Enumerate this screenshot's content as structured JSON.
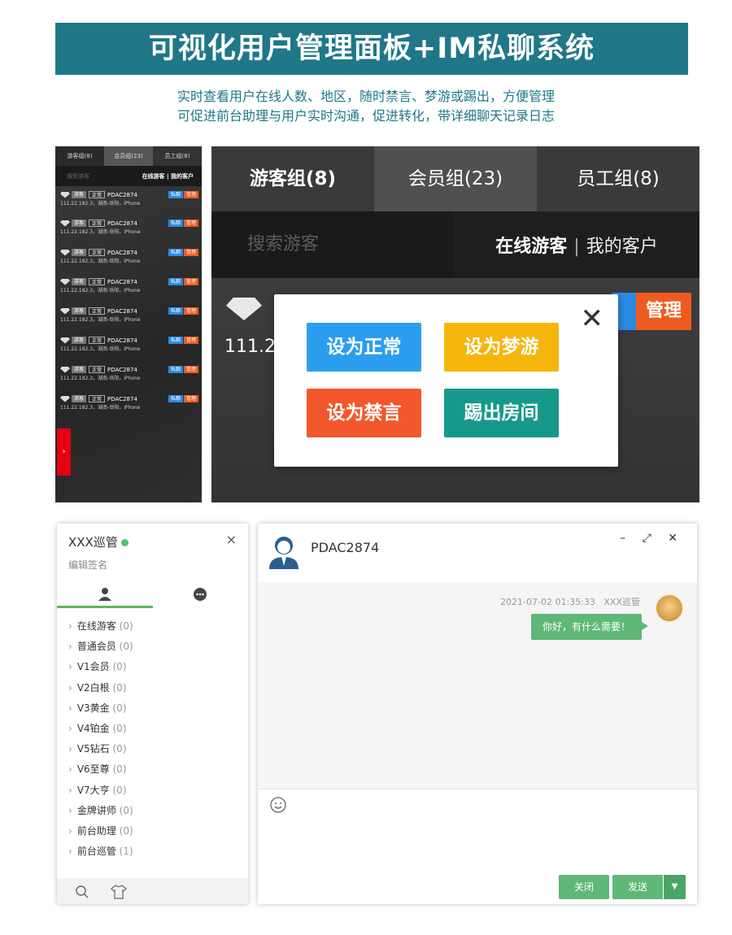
{
  "header": {
    "title": "可视化用户管理面板+IM私聊系统",
    "line1": "实时查看用户在线人数、地区，随时禁言、梦游或踢出，方便管理",
    "line2": "可促进前台助理与用户实时沟通，促进转化，带详细聊天记录日志"
  },
  "small_panel": {
    "tabs": [
      "游客组(8)",
      "会员组(23)",
      "员工组(8)"
    ],
    "search_placeholder": "搜索游客",
    "online_label": "在线游客 | 我的客户",
    "items": [
      {
        "tag": "游客",
        "status": "正常",
        "name": "PDAC2874",
        "info": "111.22.182.3，湖南-岳阳，iPhone",
        "chat": "私聊",
        "manage": "管理"
      },
      {
        "tag": "游客",
        "status": "正常",
        "name": "PDAC2874",
        "info": "111.22.182.3，湖南-岳阳，iPhone",
        "chat": "私聊",
        "manage": "管理"
      },
      {
        "tag": "游客",
        "status": "正常",
        "name": "PDAC2874",
        "info": "111.22.182.3，湖南-岳阳，iPhone",
        "chat": "私聊",
        "manage": "管理"
      },
      {
        "tag": "游客",
        "status": "正常",
        "name": "PDAC2874",
        "info": "111.22.182.3，湖南-岳阳，iPhone",
        "chat": "私聊",
        "manage": "管理"
      },
      {
        "tag": "游客",
        "status": "正常",
        "name": "PDAC2874",
        "info": "111.22.182.3，湖南-岳阳，iPhone",
        "chat": "私聊",
        "manage": "管理"
      },
      {
        "tag": "游客",
        "status": "正常",
        "name": "PDAC2874",
        "info": "111.22.182.3，湖南-岳阳，iPhone",
        "chat": "私聊",
        "manage": "管理"
      },
      {
        "tag": "游客",
        "status": "正常",
        "name": "PDAC2874",
        "info": "111.22.182.3，湖南-岳阳，iPhone",
        "chat": "私聊",
        "manage": "管理"
      },
      {
        "tag": "游客",
        "status": "正常",
        "name": "PDAC2874",
        "info": "111.22.182.3，湖南-岳阳，iPhone",
        "chat": "私聊",
        "manage": "管理"
      }
    ],
    "side_toggle": "›"
  },
  "big_panel": {
    "tabs": [
      "游客组(8)",
      "会员组(23)",
      "员工组(8)"
    ],
    "search_placeholder": "搜索游客",
    "online_label": "在线游客",
    "sep": "|",
    "my_customers": "我的客户",
    "ip_partial": "111.2",
    "manage": "管理"
  },
  "modal": {
    "close": "✕",
    "buttons": [
      {
        "label": "设为正常",
        "color": "#2b9ef0"
      },
      {
        "label": "设为梦游",
        "color": "#f5b50b"
      },
      {
        "label": "设为禁言",
        "color": "#f2582b"
      },
      {
        "label": "踢出房间",
        "color": "#16998a"
      }
    ]
  },
  "im_left": {
    "name": "XXX巡管",
    "close": "×",
    "signature": "编辑签名",
    "groups": [
      {
        "name": "在线游客",
        "count": "(0)"
      },
      {
        "name": "普通会员",
        "count": "(0)"
      },
      {
        "name": "V1会员",
        "count": "(0)"
      },
      {
        "name": "V2白根",
        "count": "(0)"
      },
      {
        "name": "V3黄金",
        "count": "(0)"
      },
      {
        "name": "V4铂金",
        "count": "(0)"
      },
      {
        "name": "V5钻石",
        "count": "(0)"
      },
      {
        "name": "V6至尊",
        "count": "(0)"
      },
      {
        "name": "V7大亨",
        "count": "(0)"
      },
      {
        "name": "金牌讲师",
        "count": "(0)"
      },
      {
        "name": "前台助理",
        "count": "(0)"
      },
      {
        "name": "前台巡管",
        "count": "(1)"
      }
    ]
  },
  "chat": {
    "title": "PDAC2874",
    "controls": "– ⤢ ✕",
    "timestamp": "2021-07-02 01:35:33",
    "sender": "XXX巡管",
    "message": "你好，有什么需要！",
    "close_button": "关闭",
    "send_button": "发送",
    "dropdown": "▼"
  },
  "colors": {
    "banner": "#1f7788",
    "accent_green": "#5fb878",
    "blue": "#2b8ae0",
    "orange": "#ef5a1f",
    "red": "#e60012"
  }
}
